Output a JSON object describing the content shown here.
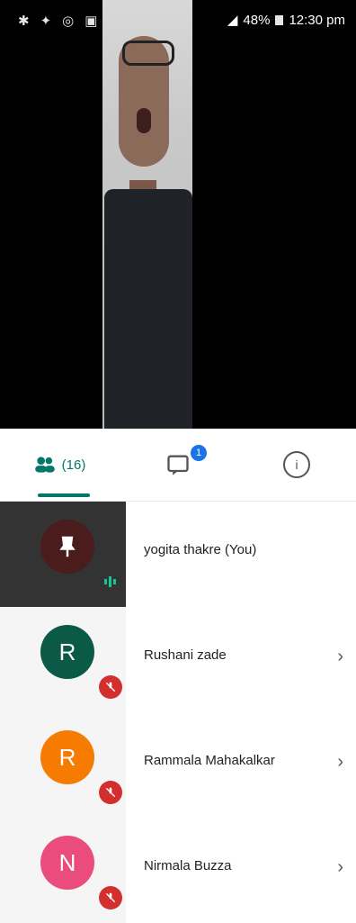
{
  "status_bar": {
    "battery": "48%",
    "time": "12:30 pm"
  },
  "tabs": {
    "people_count": "(16)",
    "chat_badge": "1"
  },
  "participants": [
    {
      "name": "yogita thakre (You)",
      "initial": "",
      "pinned": true,
      "avatar_color": "#4a1c1c"
    },
    {
      "name": "Rushani zade",
      "initial": "R",
      "avatar_color": "#0b5a48",
      "muted": true
    },
    {
      "name": "Rammala Mahakalkar",
      "initial": "R",
      "avatar_color": "#f57c00",
      "muted": true
    },
    {
      "name": "Nirmala Buzza",
      "initial": "N",
      "avatar_color": "#ea4c7e",
      "muted": true
    }
  ],
  "colors": {
    "accent": "#00796b",
    "muted_badge": "#d32f2f"
  }
}
